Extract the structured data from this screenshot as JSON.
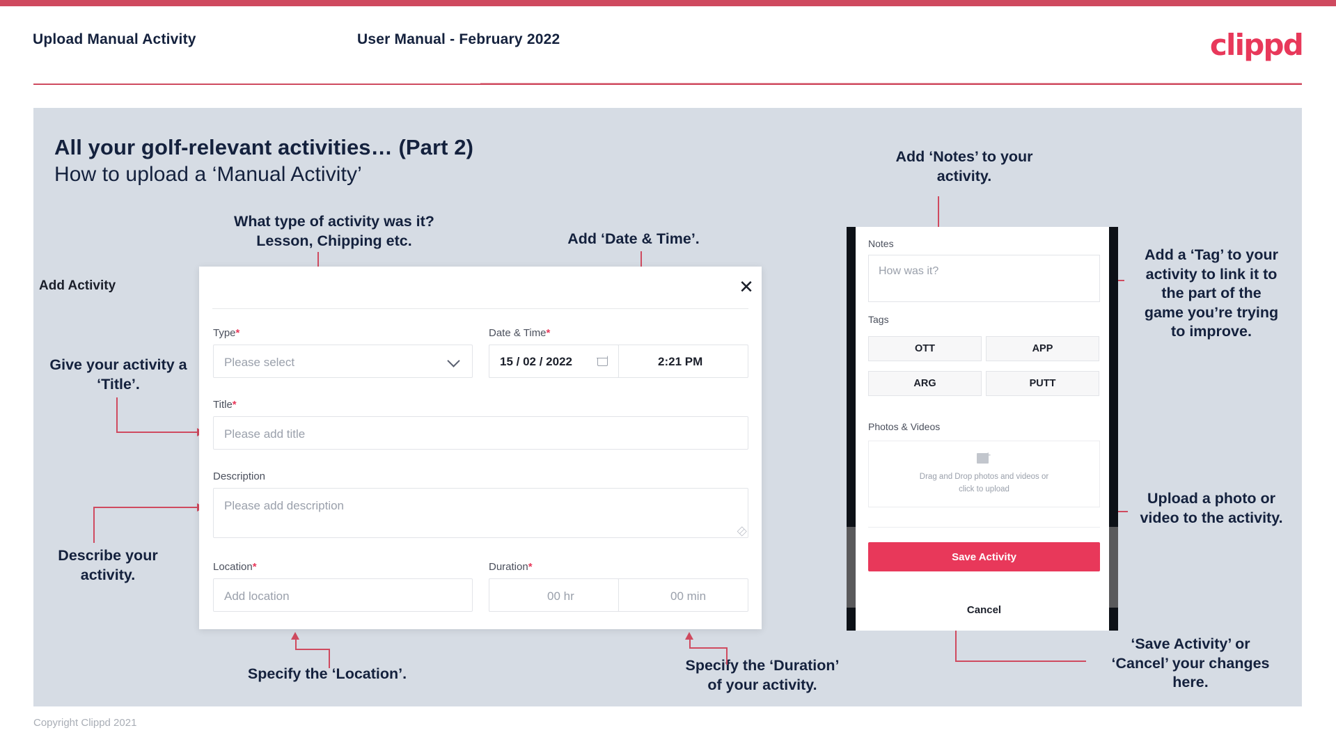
{
  "header": {
    "title": "Upload Manual Activity",
    "subtitle": "User Manual - February 2022",
    "logo": "clippd"
  },
  "slide": {
    "title_line1": "All your golf-relevant activities… (Part 2)",
    "title_line2": "How to upload a ‘Manual Activity’"
  },
  "annotations": {
    "type": "What type of activity was it?\nLesson, Chipping etc.",
    "date_time": "Add ‘Date & Time’.",
    "notes": "Add ‘Notes’ to your\nactivity.",
    "tag": "Add a ‘Tag’ to your\nactivity to link it to\nthe part of the\ngame you’re trying\nto improve.",
    "title": "Give your activity a\n‘Title’.",
    "describe": "Describe your\nactivity.",
    "location": "Specify the ‘Location’.",
    "duration": "Specify the ‘Duration’\nof your activity.",
    "upload": "Upload a photo or\nvideo to the activity.",
    "save_cancel": "‘Save Activity’ or\n‘Cancel’ your changes\nhere."
  },
  "dialog": {
    "title": "Add Activity",
    "close_icon": "✕",
    "fields": {
      "type": {
        "label": "Type",
        "required": "*",
        "placeholder": "Please select"
      },
      "datetime": {
        "label": "Date & Time",
        "required": "*",
        "date": "15 /  02  / 2022",
        "time": "2:21 PM"
      },
      "title": {
        "label": "Title",
        "required": "*",
        "placeholder": "Please add title"
      },
      "description": {
        "label": "Description",
        "required": "",
        "placeholder": "Please add description"
      },
      "location": {
        "label": "Location",
        "required": "*",
        "placeholder": "Add location"
      },
      "duration": {
        "label": "Duration",
        "required": "*",
        "hours": "00 hr",
        "minutes": "00 min"
      }
    }
  },
  "phone": {
    "notes": {
      "label": "Notes",
      "placeholder": "How was it?"
    },
    "tags": {
      "label": "Tags",
      "items": [
        "OTT",
        "APP",
        "ARG",
        "PUTT"
      ]
    },
    "photos": {
      "label": "Photos & Videos",
      "drop_line1": "Drag and Drop photos and videos or",
      "drop_line2": "click to upload",
      "plus_glyph": "+"
    },
    "save_label": "Save Activity",
    "cancel_label": "Cancel"
  },
  "footer": {
    "copyright": "Copyright Clippd 2021"
  },
  "colors": {
    "brand_pink": "#e8385a",
    "rule_red": "#cf4a5f",
    "slide_bg": "#d6dce4",
    "ink": "#14213d"
  }
}
